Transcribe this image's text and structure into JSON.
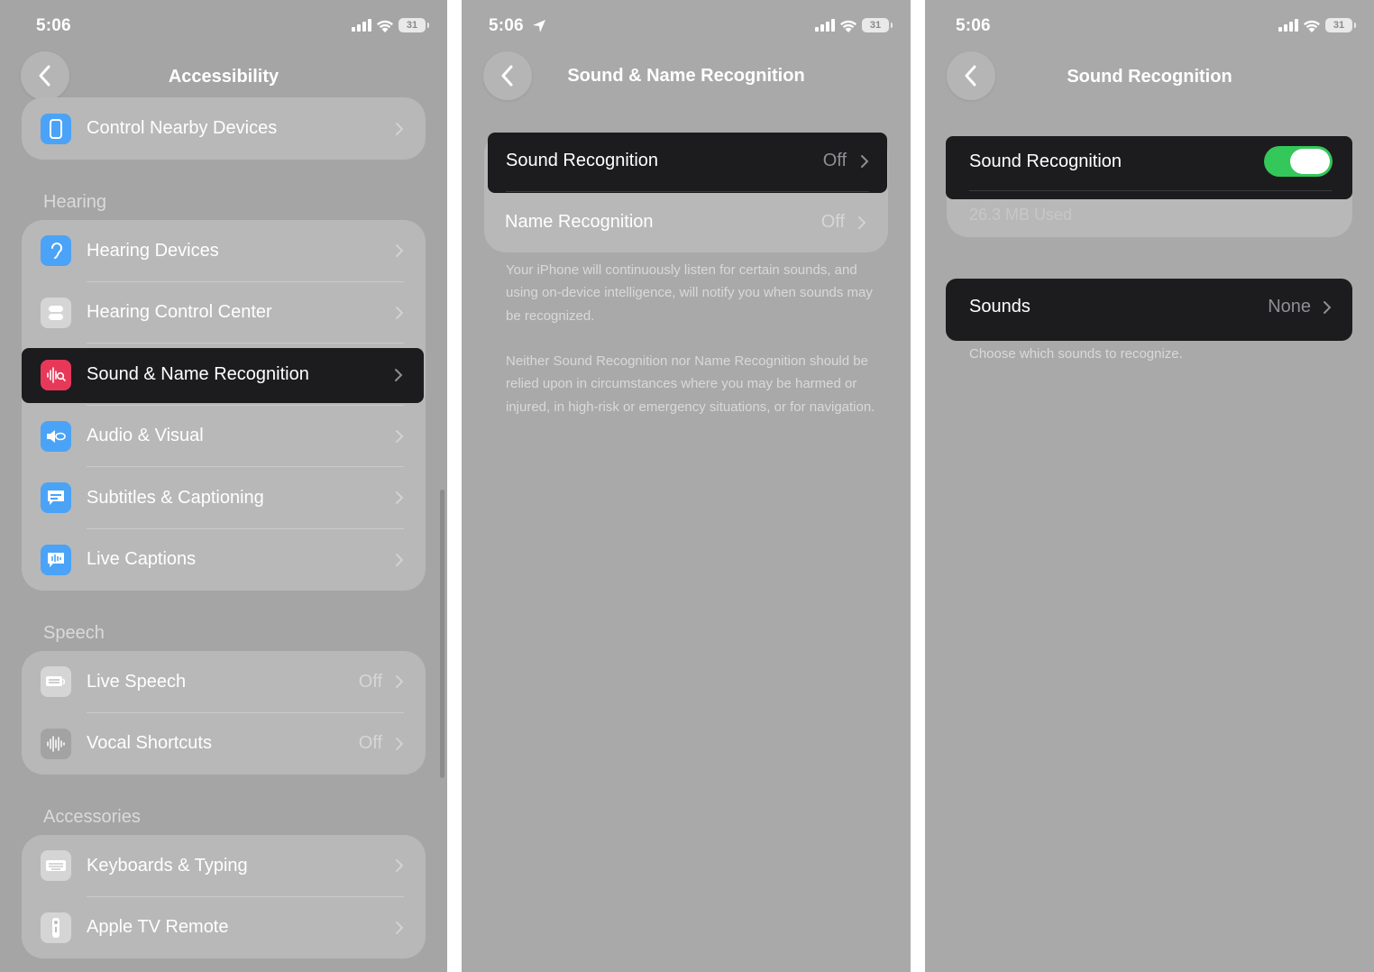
{
  "status": {
    "time": "5:06",
    "battery": "31"
  },
  "colors": {
    "accent_toggle": "#34c759",
    "highlight": "#1c1c1e",
    "sound_icon": "#e8385a",
    "blue_icon": "#4aa3f7"
  },
  "panel1": {
    "title": "Accessibility",
    "top_item": {
      "label": "Control Nearby Devices",
      "icon": "remote-device-icon"
    },
    "hearing": {
      "header": "Hearing",
      "items": [
        {
          "label": "Hearing Devices",
          "icon": "ear-icon"
        },
        {
          "label": "Hearing Control Center",
          "icon": "toggles-icon"
        },
        {
          "label": "Sound & Name Recognition",
          "icon": "sound-waveform-search-icon"
        },
        {
          "label": "Audio & Visual",
          "icon": "speaker-eye-icon"
        },
        {
          "label": "Subtitles & Captioning",
          "icon": "caption-bubble-icon"
        },
        {
          "label": "Live Captions",
          "icon": "live-caption-icon"
        }
      ]
    },
    "speech": {
      "header": "Speech",
      "items": [
        {
          "label": "Live Speech",
          "value": "Off",
          "icon": "keyboard-speech-icon"
        },
        {
          "label": "Vocal Shortcuts",
          "value": "Off",
          "icon": "waveform-icon"
        }
      ]
    },
    "accessories": {
      "header": "Accessories",
      "items": [
        {
          "label": "Keyboards & Typing",
          "icon": "keyboard-icon"
        },
        {
          "label": "Apple TV Remote",
          "icon": "tv-remote-icon"
        }
      ]
    }
  },
  "panel2": {
    "title": "Sound & Name Recognition",
    "items": [
      {
        "label": "Sound Recognition",
        "value": "Off"
      },
      {
        "label": "Name Recognition",
        "value": "Off"
      }
    ],
    "footnote1": "Your iPhone will continuously listen for certain sounds, and using on-device intelligence, will notify you when sounds may be recognized.",
    "footnote2": "Neither Sound Recognition nor Name Recognition should be relied upon in circumstances where you may be harmed or injured, in high-risk or emergency situations, or for navigation."
  },
  "panel3": {
    "title": "Sound Recognition",
    "toggle": {
      "label": "Sound Recognition",
      "state": "on"
    },
    "storage": "26.3 MB Used",
    "sounds": {
      "label": "Sounds",
      "value": "None"
    },
    "footnote": "Choose which sounds to recognize."
  }
}
